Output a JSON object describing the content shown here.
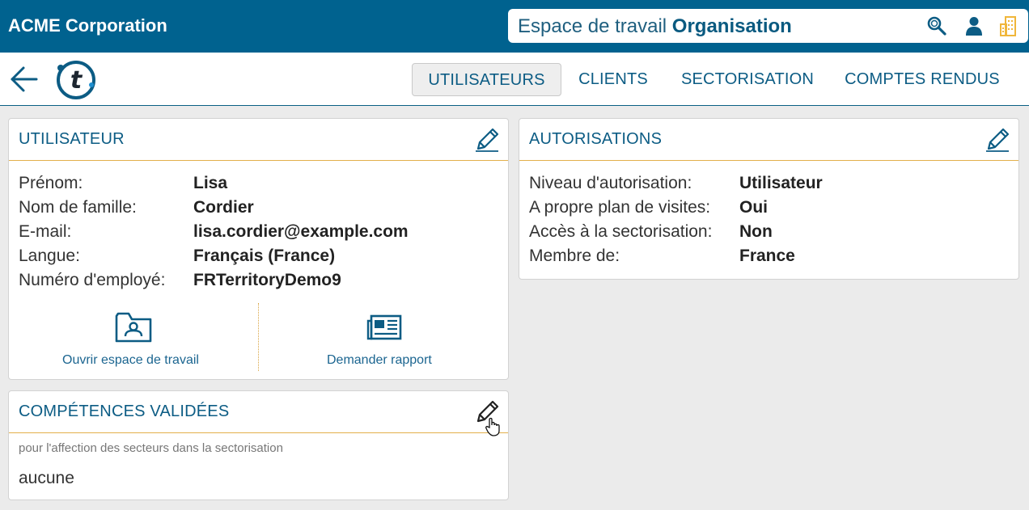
{
  "header": {
    "brand": "ACME Corporation",
    "workspace_prefix": "Espace de travail",
    "workspace_name": "Organisation",
    "icons": [
      "search-icon",
      "user-icon",
      "building-icon"
    ]
  },
  "nav": {
    "tabs": [
      {
        "label": "UTILISATEURS",
        "active": true
      },
      {
        "label": "CLIENTS",
        "active": false
      },
      {
        "label": "SECTORISATION",
        "active": false
      },
      {
        "label": "COMPTES RENDUS",
        "active": false
      }
    ]
  },
  "user_card": {
    "title": "UTILISATEUR",
    "fields": [
      {
        "label": "Prénom:",
        "value": "Lisa"
      },
      {
        "label": "Nom de famille:",
        "value": "Cordier"
      },
      {
        "label": "E-mail:",
        "value": "lisa.cordier@example.com"
      },
      {
        "label": "Langue:",
        "value": "Français (France)"
      },
      {
        "label": "Numéro d'employé:",
        "value": "FRTerritoryDemo9"
      }
    ],
    "actions": [
      {
        "label": "Ouvrir espace de travail",
        "icon": "folder-user-icon"
      },
      {
        "label": "Demander rapport",
        "icon": "newspaper-icon"
      }
    ]
  },
  "skills_card": {
    "title": "COMPÉTENCES VALIDÉES",
    "note": "pour l'affection des secteurs dans la sectorisation",
    "value": "aucune"
  },
  "auth_card": {
    "title": "AUTORISATIONS",
    "fields": [
      {
        "label": "Niveau d'autorisation:",
        "value": "Utilisateur"
      },
      {
        "label": "A propre plan de visites:",
        "value": "Oui"
      },
      {
        "label": "Accès à la sectorisation:",
        "value": "Non"
      },
      {
        "label": "Membre de:",
        "value": "France"
      }
    ]
  },
  "colors": {
    "header": "#00628f",
    "accent_line": "#e3b04b",
    "title": "#0c5c84",
    "building_icon": "#f0b63a"
  }
}
